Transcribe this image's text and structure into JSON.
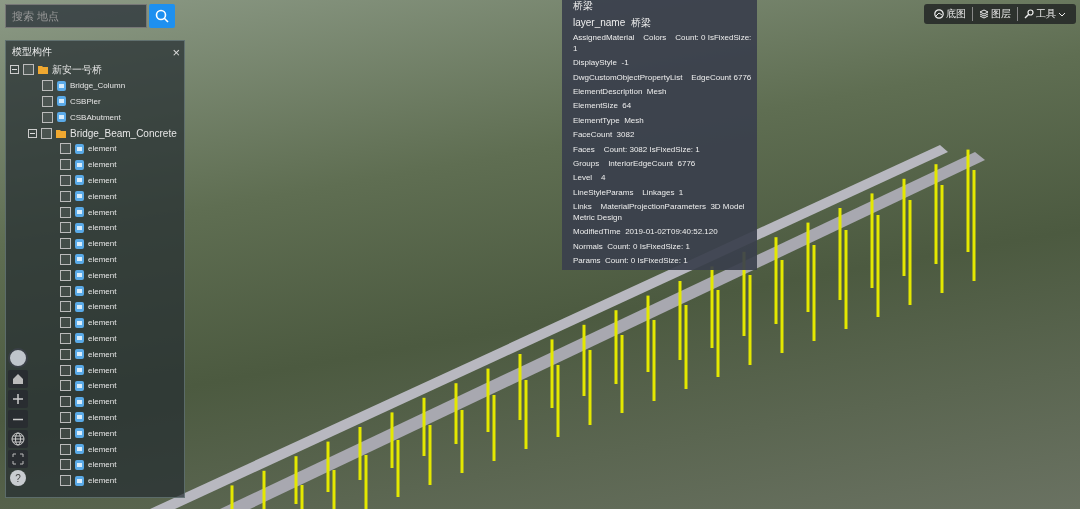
{
  "search": {
    "placeholder": "搜索 地点"
  },
  "panel": {
    "title": "模型构件",
    "close": "×"
  },
  "tree": [
    {
      "label": "新安一号桥",
      "checked": false,
      "expanded": true,
      "children": [
        {
          "label": "Bridge_Column",
          "checked": false
        },
        {
          "label": "CSBPier",
          "checked": false
        },
        {
          "label": "CSBAbutment",
          "checked": false
        },
        {
          "label": "Bridge_Beam_Concrete",
          "checked": false,
          "expanded": true,
          "children": [
            {
              "label": "element",
              "checked": false
            },
            {
              "label": "element",
              "checked": false
            },
            {
              "label": "element",
              "checked": false
            },
            {
              "label": "element",
              "checked": false
            },
            {
              "label": "element",
              "checked": false
            },
            {
              "label": "element",
              "checked": false
            },
            {
              "label": "element",
              "checked": false
            },
            {
              "label": "element",
              "checked": false
            },
            {
              "label": "element",
              "checked": false
            },
            {
              "label": "element",
              "checked": false
            },
            {
              "label": "element",
              "checked": false
            },
            {
              "label": "element",
              "checked": false
            },
            {
              "label": "element",
              "checked": false
            },
            {
              "label": "element",
              "checked": false
            },
            {
              "label": "element",
              "checked": false
            },
            {
              "label": "element",
              "checked": false
            },
            {
              "label": "element",
              "checked": false
            },
            {
              "label": "element",
              "checked": false
            },
            {
              "label": "element",
              "checked": false
            },
            {
              "label": "element",
              "checked": false
            },
            {
              "label": "element",
              "checked": false
            },
            {
              "label": "element",
              "checked": false
            }
          ]
        }
      ]
    }
  ],
  "popup": {
    "title": "桥梁",
    "lines": [
      "layer_name  桥梁",
      "AssignedMaterial    Colors    Count: 0 IsFixedSize: 1",
      "DisplayStyle  -1",
      "DwgCustomObjectPropertyList    EdgeCount 6776",
      "ElementDescription  Mesh",
      "ElementSize  64",
      "ElementType  Mesh",
      "FaceCount  3082",
      "Faces    Count: 3082 IsFixedSize: 1",
      "Groups    InteriorEdgeCount  6776",
      "Level    4",
      "LineStyleParams    Linkages  1",
      "Links    MaterialProjectionParameters  3D Model    Metric Design",
      "ModifiedTime  2019-01-02T09:40:52.120",
      "Normals  Count: 0 IsFixedSize: 1",
      "Params  Count: 0 IsFixedSize: 1"
    ]
  },
  "toolbar": [
    {
      "kind": "basemap",
      "label": "底图"
    },
    {
      "kind": "layers",
      "label": "图层"
    },
    {
      "kind": "tools",
      "label": "工具",
      "dropdown": true
    }
  ],
  "controls": [
    {
      "kind": "compass"
    },
    {
      "kind": "home"
    },
    {
      "kind": "zoom-in"
    },
    {
      "kind": "zoom-out"
    },
    {
      "kind": "globe"
    },
    {
      "kind": "fullscreen"
    },
    {
      "kind": "help",
      "label": "?"
    }
  ]
}
